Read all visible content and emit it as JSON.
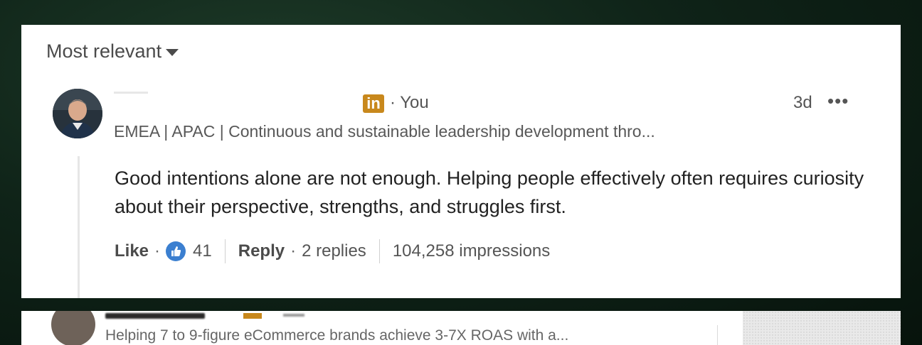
{
  "sort": {
    "label": "Most relevant"
  },
  "comment": {
    "badge": "in",
    "you_label": "· You",
    "time": "3d",
    "more_label": "•••",
    "headline": "EMEA | APAC | Continuous and sustainable leadership development thro...",
    "text": "Good intentions alone are not enough. Helping people effectively often requires curiosity about their perspective, strengths, and struggles first.",
    "actions": {
      "like_label": "Like",
      "reaction_count": "41",
      "reply_label": "Reply",
      "replies": "2 replies",
      "impressions": "104,258 impressions"
    }
  },
  "next_comment": {
    "headline": "Helping 7 to 9-figure eCommerce brands achieve 3-7X ROAS with a..."
  },
  "colors": {
    "linkedin_badge": "#c8881c",
    "reaction_blue": "#3b7fd0",
    "background": "#0f2318"
  },
  "icons": {
    "sort_caret": "caret-down-icon",
    "reaction": "like-reaction-icon",
    "more": "more-options-icon"
  }
}
